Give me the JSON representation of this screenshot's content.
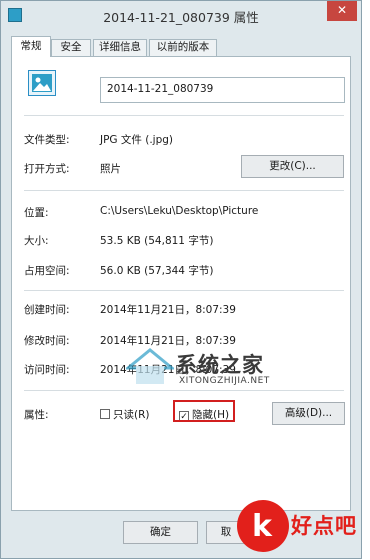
{
  "window": {
    "title": "2014-11-21_080739 属性",
    "close_glyph": "✕"
  },
  "tabs": [
    "常规",
    "安全",
    "详细信息",
    "以前的版本"
  ],
  "general": {
    "file_name": "2014-11-21_080739",
    "file_type_label": "文件类型:",
    "file_type_value": "JPG 文件 (.jpg)",
    "open_with_label": "打开方式:",
    "open_with_value": "照片",
    "change_button": "更改(C)...",
    "location_label": "位置:",
    "location_value": "C:\\Users\\Leku\\Desktop\\Picture",
    "size_label": "大小:",
    "size_value": "53.5 KB (54,811 字节)",
    "size_on_disk_label": "占用空间:",
    "size_on_disk_value": "56.0 KB (57,344 字节)",
    "created_label": "创建时间:",
    "created_value": "2014年11月21日，8:07:39",
    "modified_label": "修改时间:",
    "modified_value": "2014年11月21日，8:07:39",
    "accessed_label": "访问时间:",
    "accessed_value": "2014年11月21日，8:07:39",
    "attributes_label": "属性:",
    "readonly_label": "只读(R)",
    "readonly_checked": false,
    "hidden_label": "隐藏(H)",
    "hidden_checked": true,
    "check_glyph": "✓",
    "advanced_button": "高级(D)..."
  },
  "footer": {
    "ok_button": "确定",
    "cancel_partial": "取"
  },
  "watermark": {
    "main": "系统之家",
    "sub": "XITONGZHIJIA.NET"
  },
  "badge": {
    "letter": "k",
    "text": "好点吧"
  },
  "colors": {
    "highlight": "#d21f1f",
    "badge_red": "#e2201b",
    "accent": "#2d9ec7"
  }
}
